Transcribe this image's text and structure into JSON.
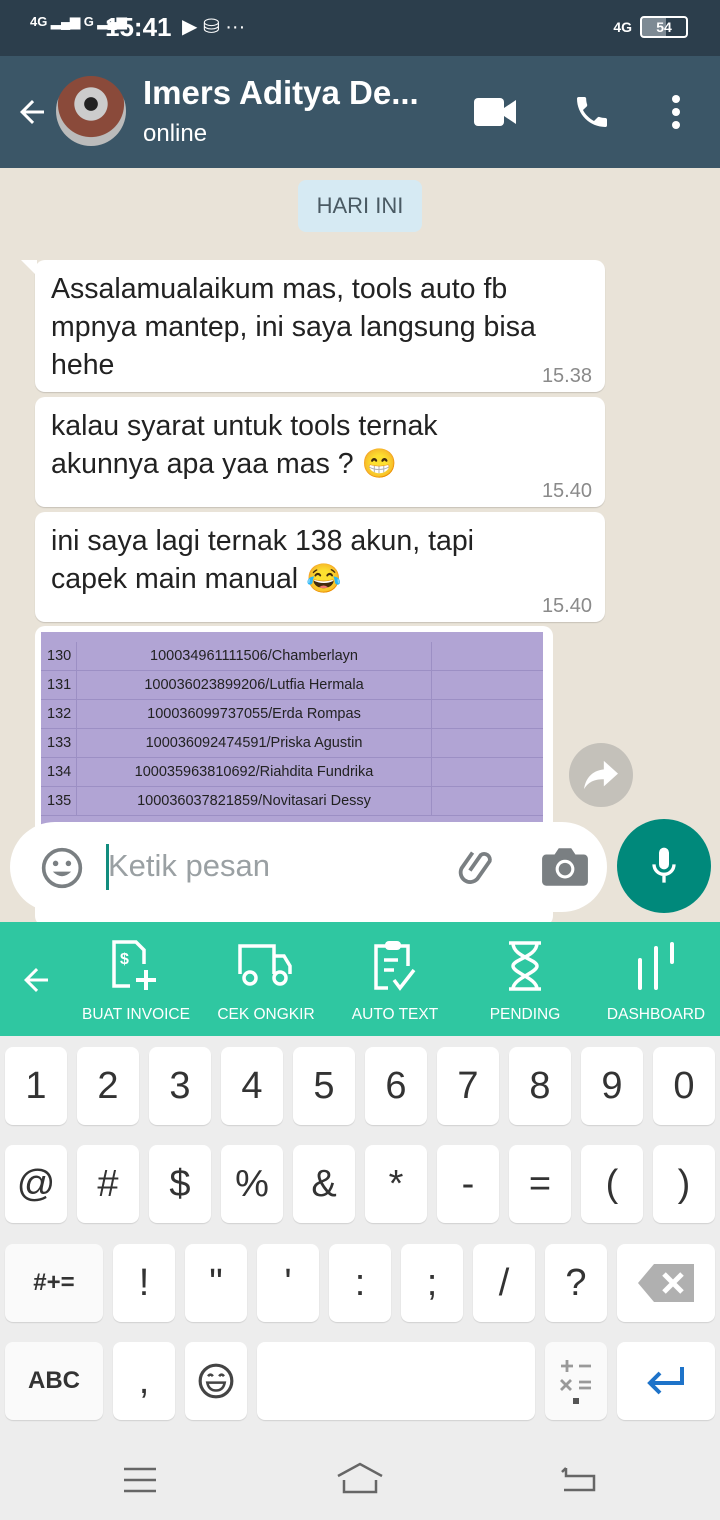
{
  "status_bar": {
    "signal1": "4G",
    "signal2": "G",
    "time": "15:41",
    "network": "4G",
    "battery": "54"
  },
  "header": {
    "contact_name": "Imers Aditya De...",
    "status": "online"
  },
  "chat": {
    "date_chip": "HARI INI",
    "messages": [
      {
        "text": "Assalamualaikum mas, tools auto fb mpnya mantep, ini saya langsung bisa hehe",
        "time": "15.38"
      },
      {
        "text": "kalau syarat untuk tools ternak akunnya apa yaa mas ? 😁",
        "time": "15.40"
      },
      {
        "text": "ini saya lagi ternak 138 akun, tapi capek main manual  😂",
        "time": "15.40"
      }
    ],
    "image_rows": [
      {
        "no": "130",
        "value": "100034961111506/Chamberlayn"
      },
      {
        "no": "131",
        "value": "100036023899206/Lutfia Hermala"
      },
      {
        "no": "132",
        "value": "100036099737055/Erda Rompas"
      },
      {
        "no": "133",
        "value": "100036092474591/Priska Agustin"
      },
      {
        "no": "134",
        "value": "100035963810692/Riahdita Fundrika"
      },
      {
        "no": "135",
        "value": "100036037821859/Novitasari Dessy"
      }
    ]
  },
  "composer": {
    "placeholder": "Ketik pesan"
  },
  "toolbar": {
    "items": [
      "BUAT INVOICE",
      "CEK ONGKIR",
      "AUTO TEXT",
      "PENDING",
      "DASHBOARD"
    ]
  },
  "keyboard": {
    "row1": [
      "1",
      "2",
      "3",
      "4",
      "5",
      "6",
      "7",
      "8",
      "9",
      "0"
    ],
    "row2": [
      "@",
      "#",
      "$",
      "%",
      "&",
      "*",
      "-",
      "=",
      "(",
      ")"
    ],
    "row3": [
      "#+=",
      "!",
      "\"",
      "'",
      ":",
      ";",
      "/",
      "?"
    ],
    "row4": [
      "ABC",
      ","
    ]
  },
  "colors": {
    "header": "#3b5667",
    "toolbar": "#2fc7a1",
    "mic": "#00897b"
  }
}
